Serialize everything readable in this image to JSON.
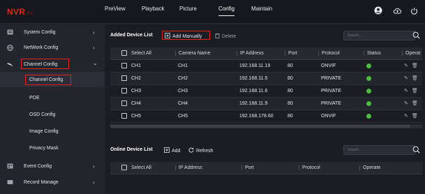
{
  "app": {
    "logo": "NVR",
    "logo_sub": "Kit"
  },
  "topnav": [
    {
      "label": "PreView",
      "active": false
    },
    {
      "label": "Playback",
      "active": false
    },
    {
      "label": "Picture",
      "active": false
    },
    {
      "label": "Config",
      "active": true
    },
    {
      "label": "Maintain",
      "active": false
    }
  ],
  "top_icons": [
    "user-avatar-icon",
    "cloud-upload-icon",
    "power-icon"
  ],
  "sidebar": {
    "items": [
      {
        "label": "System Config",
        "icon": "system-config-icon",
        "chevron": "›"
      },
      {
        "label": "NetWork Config",
        "icon": "network-icon",
        "chevron": "›"
      },
      {
        "label": "Channel Config",
        "icon": "camera-icon",
        "chevron": "⌄"
      },
      {
        "label": "Event Config",
        "icon": "event-icon",
        "chevron": "›"
      },
      {
        "label": "Record Manage",
        "icon": "record-icon",
        "chevron": "›"
      }
    ],
    "subitems": [
      {
        "label": "Channel Config",
        "selected": true
      },
      {
        "label": "POE",
        "selected": false
      },
      {
        "label": "OSD Config",
        "selected": false
      },
      {
        "label": "Image Config",
        "selected": false
      },
      {
        "label": "Privacy Mask",
        "selected": false
      }
    ]
  },
  "added": {
    "title": "Added Device List",
    "add_label": "Add Manually",
    "delete_label": "Delete",
    "search_placeholder": "Search...",
    "headers": [
      "Select All",
      "Camera Name",
      "IP Address",
      "Port",
      "Protocol",
      "Status",
      "Operat"
    ],
    "rows": [
      {
        "ch": "CH1",
        "name": "CH1",
        "ip": "192.168.11.19",
        "port": "80",
        "protocol": "ONVIF"
      },
      {
        "ch": "CH2",
        "name": "CH2",
        "ip": "192.168.11.5",
        "port": "80",
        "protocol": "PRIVATE"
      },
      {
        "ch": "CH3",
        "name": "CH3",
        "ip": "192.168.11.6",
        "port": "80",
        "protocol": "PRIVATE"
      },
      {
        "ch": "CH4",
        "name": "CH4",
        "ip": "192.168.11.9",
        "port": "80",
        "protocol": "PRIVATE"
      },
      {
        "ch": "CH5",
        "name": "CH5",
        "ip": "192.168.178.60",
        "port": "80",
        "protocol": "ONVIF"
      }
    ]
  },
  "online": {
    "title": "Online Device List",
    "add_label": "Add",
    "refresh_label": "Refresh",
    "search_placeholder": "Search...",
    "headers": [
      "Select All",
      "IP Address",
      "Port",
      "Protocol",
      "Operate"
    ]
  },
  "colors": {
    "accent_red": "#e0241b",
    "status_green": "#4cbb3f"
  }
}
